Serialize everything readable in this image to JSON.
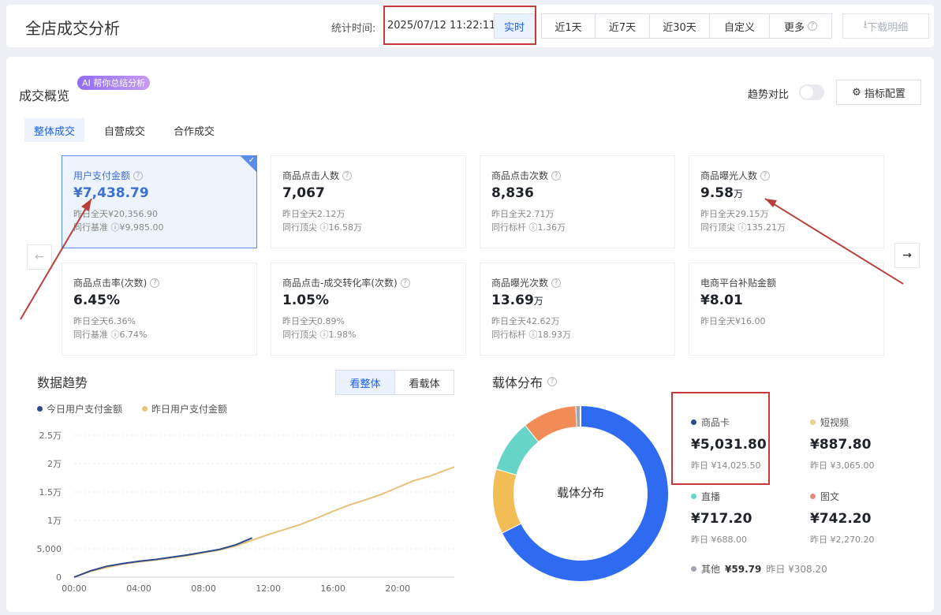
{
  "header": {
    "title": "全店成交分析",
    "stat_label": "统计时间:",
    "stat_time": "2025/07/12 11:22:11",
    "ranges": [
      "实时",
      "近1天",
      "近7天",
      "近30天",
      "自定义",
      "更多"
    ],
    "download": "下载明细"
  },
  "overview": {
    "title": "成交概览",
    "ai_badge": "AI 帮你总结分析",
    "trend_compare": "趋势对比",
    "config": "指标配置",
    "tabs": [
      "整体成交",
      "自营成交",
      "合作成交"
    ],
    "cards": [
      {
        "label": "用户支付金额",
        "value": "¥7,438.79",
        "unit": "",
        "sub1": "昨日全天¥20,356.90",
        "sub2": "同行基准 ⓘ¥9,985.00"
      },
      {
        "label": "商品点击人数",
        "value": "7,067",
        "unit": "",
        "sub1": "昨日全天2.12万",
        "sub2": "同行顶尖 ⓘ16.58万"
      },
      {
        "label": "商品点击次数",
        "value": "8,836",
        "unit": "",
        "sub1": "昨日全天2.71万",
        "sub2": "同行标杆 ⓘ1.36万"
      },
      {
        "label": "商品曝光人数",
        "value": "9.58",
        "unit": "万",
        "sub1": "昨日全天29.15万",
        "sub2": "同行顶尖 ⓘ135.21万"
      },
      {
        "label": "商品点击率(次数)",
        "value": "6.45%",
        "unit": "",
        "sub1": "昨日全天6.36%",
        "sub2": "同行基准 ⓘ6.74%"
      },
      {
        "label": "商品点击-成交转化率(次数)",
        "value": "1.05%",
        "unit": "",
        "sub1": "昨日全天0.89%",
        "sub2": "同行顶尖 ⓘ1.98%"
      },
      {
        "label": "商品曝光次数",
        "value": "13.69",
        "unit": "万",
        "sub1": "昨日全天42.62万",
        "sub2": "同行标杆 ⓘ18.93万"
      },
      {
        "label": "电商平台补贴金额",
        "value": "¥8.01",
        "unit": "",
        "sub1": "昨日全天¥16.00",
        "sub2": ""
      }
    ]
  },
  "trend": {
    "title": "数据趋势",
    "btn_overall": "看整体",
    "btn_carrier": "看载体"
  },
  "chart_data": {
    "type": "line",
    "title": "",
    "xlabel": "",
    "ylabel": "",
    "x_ticks": [
      "00:00",
      "04:00",
      "08:00",
      "12:00",
      "16:00",
      "20:00"
    ],
    "y_ticks": [
      "0",
      "5,000",
      "1万",
      "1.5万",
      "2万",
      "2.5万"
    ],
    "ylim": [
      0,
      25000
    ],
    "xlim": [
      0,
      23.5
    ],
    "series": [
      {
        "name": "今日用户支付金额",
        "color": "#2f4a8a",
        "x": [
          0,
          1,
          2,
          3,
          4,
          5,
          6,
          7,
          8,
          9,
          10,
          11
        ],
        "y": [
          0,
          1100,
          1900,
          2400,
          2800,
          3100,
          3500,
          3900,
          4400,
          4900,
          5700,
          6900
        ]
      },
      {
        "name": "昨日用户支付金额",
        "color": "#e8c27a",
        "x": [
          0,
          1,
          2,
          3,
          4,
          5,
          6,
          7,
          8,
          9,
          10,
          11,
          12,
          13,
          14,
          15,
          16,
          17,
          18,
          19,
          20,
          21,
          22,
          23,
          23.5
        ],
        "y": [
          0,
          1000,
          1700,
          2300,
          2700,
          3000,
          3400,
          3800,
          4300,
          4800,
          5500,
          6500,
          7500,
          8400,
          9300,
          10400,
          11600,
          12700,
          13600,
          14600,
          15800,
          17000,
          17800,
          18900,
          19400
        ]
      }
    ]
  },
  "distribution": {
    "title": "载体分布",
    "center": "载体分布",
    "items": [
      {
        "name": "商品卡",
        "value": "¥5,031.80",
        "yesterday": "昨日 ¥14,025.50",
        "color": "#2f6bf0",
        "share": 5031.8
      },
      {
        "name": "短视频",
        "value": "¥887.80",
        "yesterday": "昨日 ¥3,065.00",
        "color": "#f2bd55",
        "share": 887.8
      },
      {
        "name": "直播",
        "value": "¥717.20",
        "yesterday": "昨日 ¥688.00",
        "color": "#67d4c8",
        "share": 717.2
      },
      {
        "name": "图文",
        "value": "¥742.20",
        "yesterday": "昨日 ¥2,270.20",
        "color": "#f28c57",
        "share": 742.2
      },
      {
        "name": "其他",
        "value": "¥59.79",
        "yesterday": "昨日 ¥308.20",
        "color": "#9ea4b0",
        "share": 59.79
      }
    ]
  }
}
